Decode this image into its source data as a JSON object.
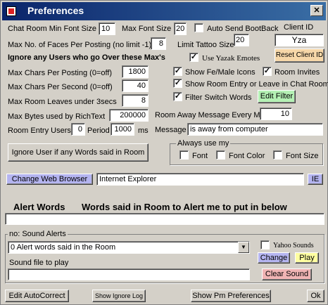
{
  "title": "Preferences",
  "close_symbol": "✕",
  "font": {
    "min_label": "Chat Room Min Font Size",
    "min_value": "10",
    "max_label": "Max Font Size",
    "max_value": "20",
    "auto_bootback_label": "Auto Send BootBack",
    "client_id_label": "Client ID",
    "client_id_value": "Yza"
  },
  "faces": {
    "label": "Max No. of Faces Per Posting (no limit -1)",
    "value": "8",
    "tattoo_label": "Limit Tattoo Size",
    "tattoo_value": "20"
  },
  "ignore_heading": "Ignore any Users who go Over these Max's",
  "yazak_emotes_label": "Use Yazak Emotes",
  "yazak_emotes_checked": "✓",
  "reset_client_id_label": "Reset Client ID",
  "limits": [
    {
      "label": "Max Chars Per Posting  (0=off)",
      "value": "1800"
    },
    {
      "label": "Max Chars Per Second  (0=off)",
      "value": "40"
    },
    {
      "label": "Max Room Leaves under 3secs",
      "value": "8"
    },
    {
      "label": "Max Bytes used by RichText",
      "value": "200000"
    }
  ],
  "options": {
    "fe_male_icons": {
      "label": "Show Fe/Male Icons",
      "mark": "✓"
    },
    "room_invites": {
      "label": "Room Invites",
      "mark": "✓"
    },
    "room_entry": {
      "label": "Show Room Entry or Leave in Chat Room",
      "mark": "✓"
    },
    "filter_switch": {
      "label": "Filter Switch Words",
      "mark": "✓"
    },
    "edit_filter_label": "Edit Filter"
  },
  "entry": {
    "users_label": "Room Entry Users",
    "users_value": "0",
    "period_label": "Period",
    "period_value": "1000",
    "ms_label": "ms"
  },
  "away": {
    "every_label": "Room Away Message Every Mins",
    "every_value": "10",
    "message_label": "Message",
    "message_value": "is away from computer"
  },
  "ignore_words_button": "Ignore User if any Words said in Room",
  "always_use": {
    "title": "Always use my",
    "font_label": "Font",
    "font_color_label": "Font Color",
    "font_size_label": "Font Size"
  },
  "browser": {
    "button_label": "Change Web Browser",
    "value": "Internet Explorer",
    "badge": "IE"
  },
  "alert": {
    "heading": "Alert Words",
    "subheading": "Words said in Room to Alert me to put in below",
    "words_value": ""
  },
  "sound": {
    "group_title": "no: Sound Alerts",
    "selected": "0   Alert words said in the Room",
    "yahoo_label": "Yahoo Sounds",
    "file_label": "Sound file to play",
    "file_value": "",
    "change_label": "Change",
    "play_label": "Play",
    "clear_label": "Clear Sound"
  },
  "footer": {
    "autocorrect": "Edit AutoCorrect",
    "ignore_log": "Show Ignore Log",
    "pm_prefs": "Show Pm Preferences",
    "ok": "Ok"
  },
  "colors": {
    "title_start": "#0a246a",
    "title_end": "#3a6ea5",
    "reset_button": "#f6d7a8",
    "edit_filter": "#b4f0b4",
    "browser_button": "#b4b4f0",
    "ie_badge": "#b4b4f0",
    "change_button": "#b4b4f0",
    "play_button": "#ffffa0",
    "clear_button": "#f0b4b4"
  }
}
